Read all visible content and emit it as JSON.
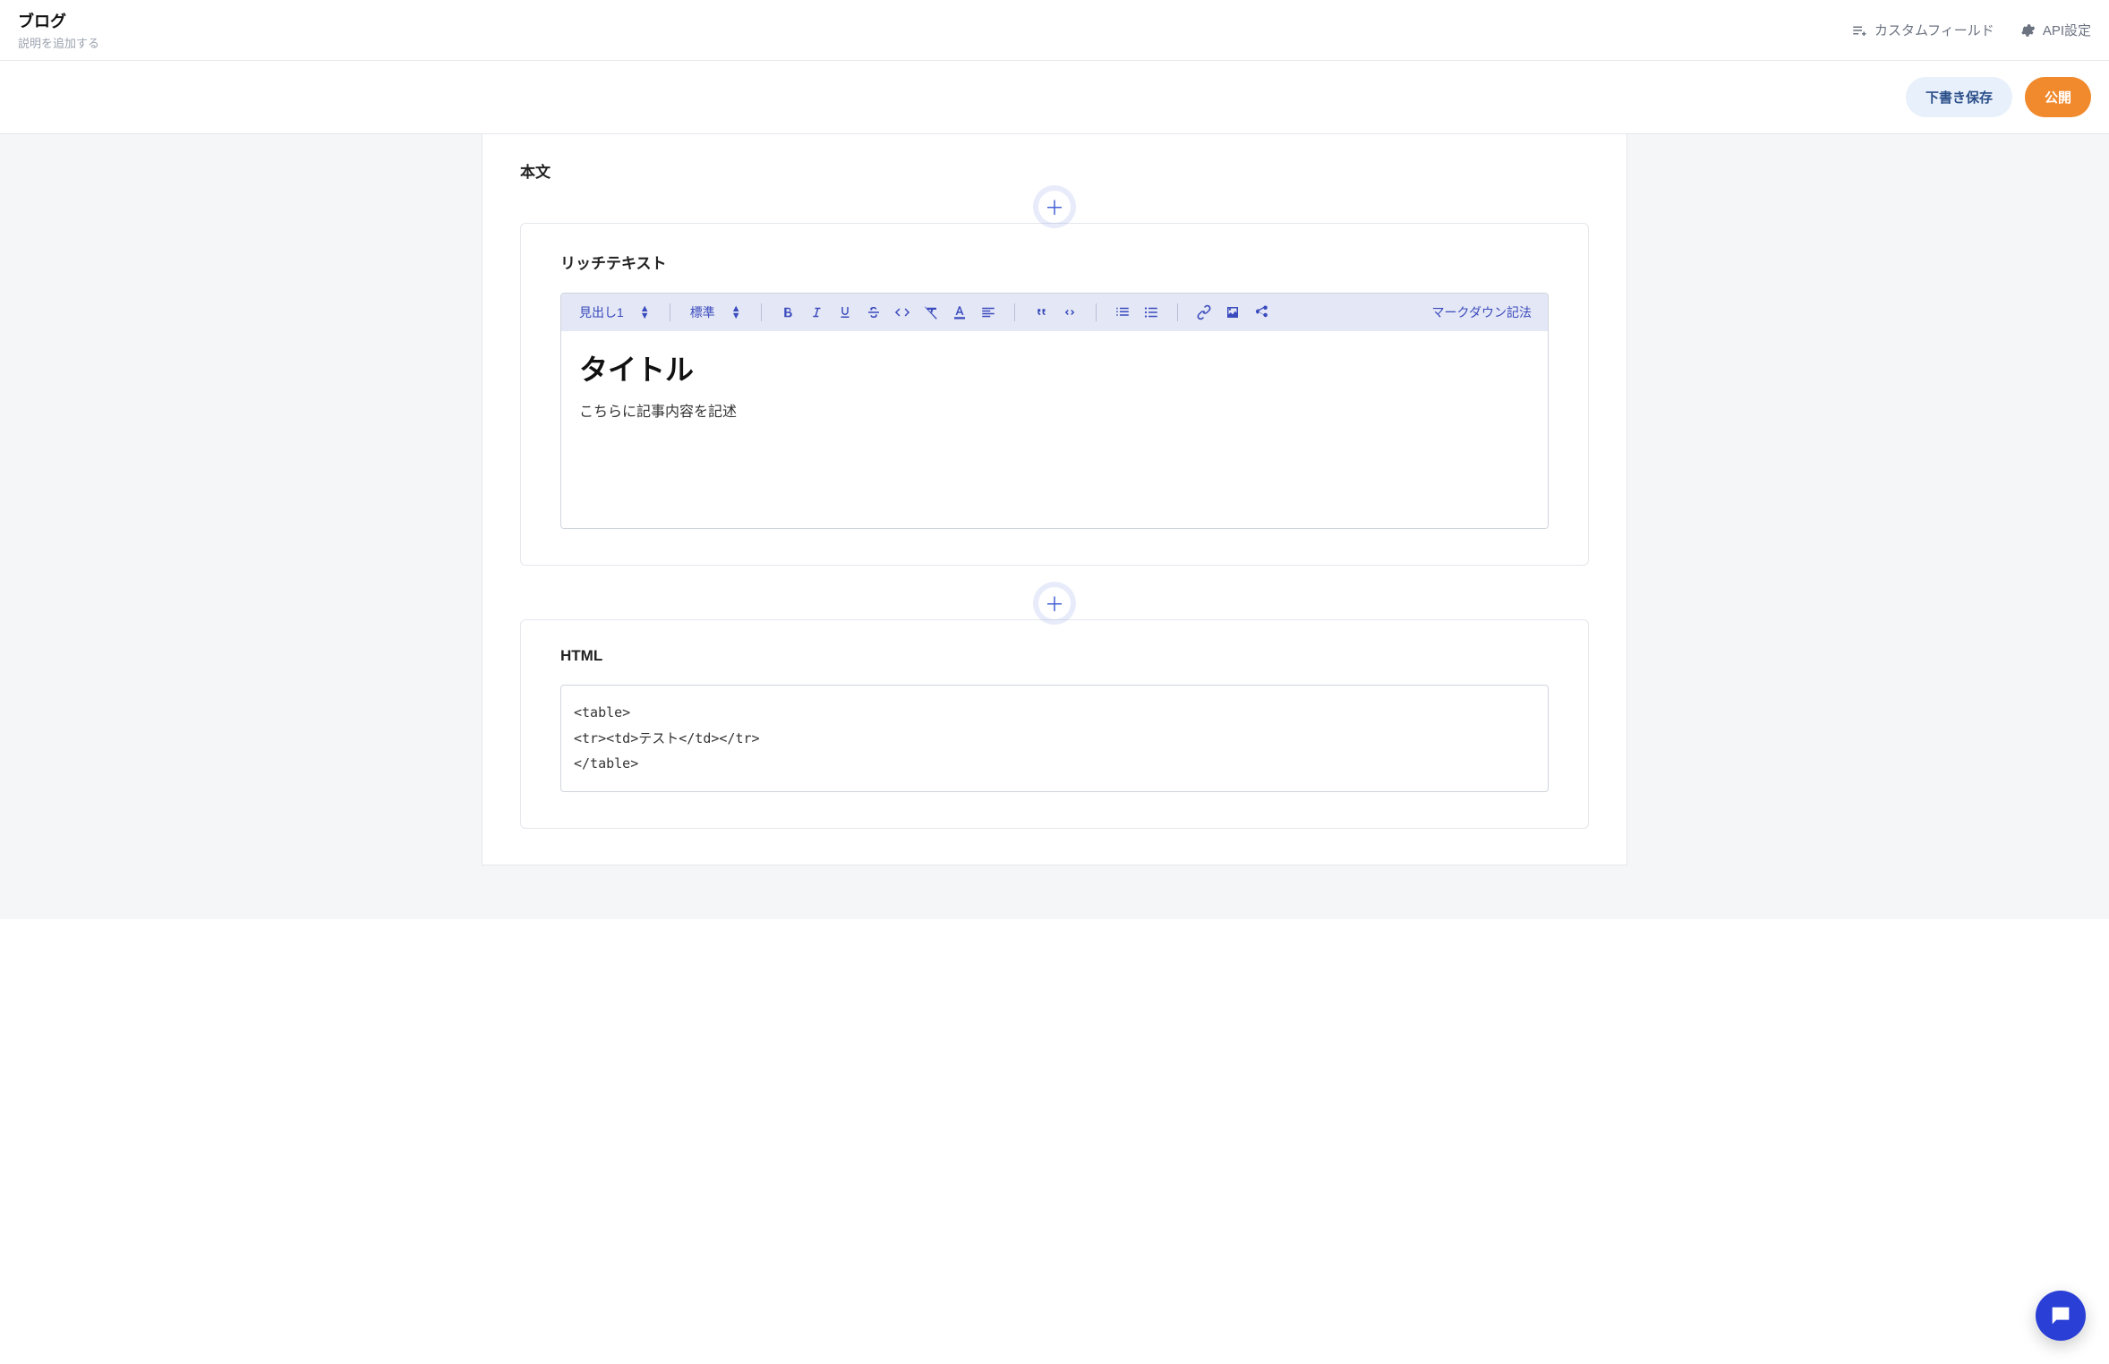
{
  "header": {
    "title": "ブログ",
    "subtitle": "説明を追加する",
    "custom_field_label": "カスタムフィールド",
    "api_settings_label": "API設定"
  },
  "actions": {
    "draft_label": "下書き保存",
    "publish_label": "公開"
  },
  "content": {
    "section_heading": "本文",
    "richtext": {
      "block_title": "リッチテキスト",
      "heading_select": "見出し1",
      "style_select": "標準",
      "markdown_hint": "マークダウン記法",
      "body_heading": "タイトル",
      "body_paragraph": "こちらに記事内容を記述"
    },
    "html": {
      "block_title": "HTML",
      "lines": [
        "<table>",
        "  <tr><td>テスト</td></tr>",
        "</table>"
      ]
    }
  }
}
